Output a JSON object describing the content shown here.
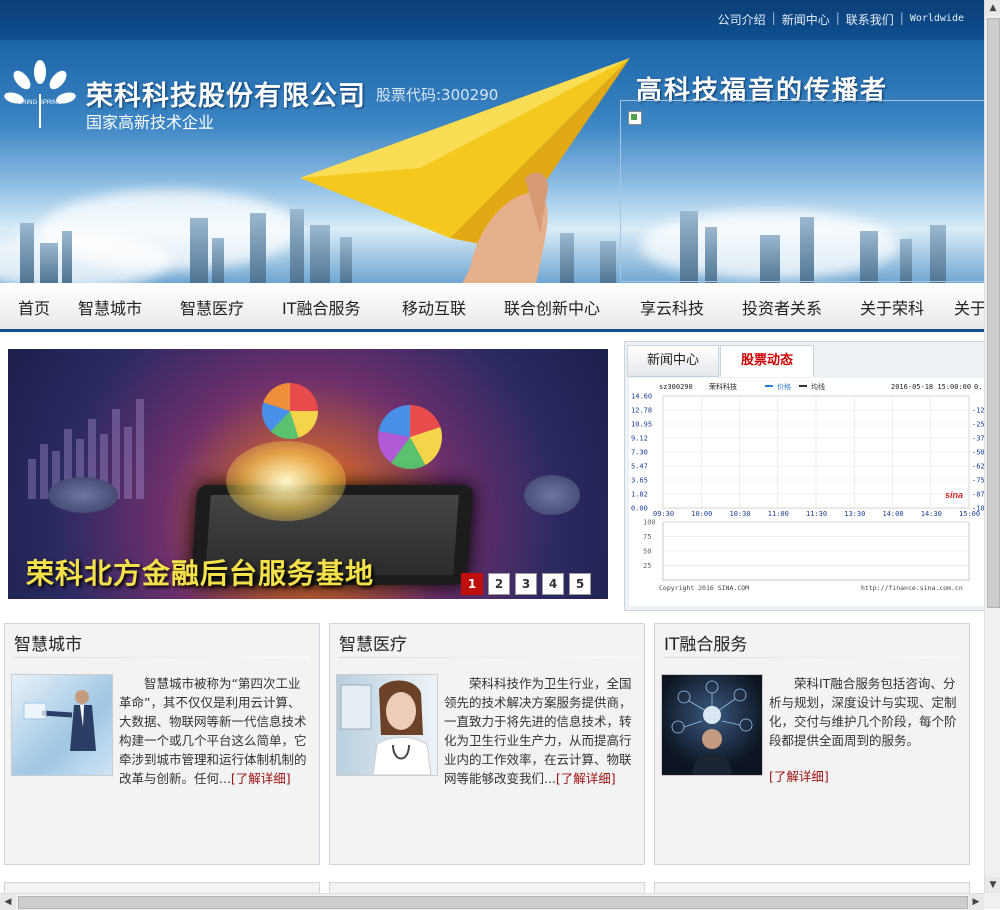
{
  "topbar": {
    "links": [
      "公司介绍",
      "新闻中心",
      "联系我们",
      "Worldwide"
    ]
  },
  "banner": {
    "company_name": "荣科科技股份有限公司",
    "stock_code": "股票代码:300290",
    "subtitle": "国家高新技术企业",
    "slogan": "高科技福音的传播者",
    "logo_text": "BRING SPRING"
  },
  "nav": {
    "items": [
      "首页",
      "智慧城市",
      "智慧医疗",
      "IT融合服务",
      "移动互联",
      "联合创新中心",
      "享云科技",
      "投资者关系",
      "关于荣科",
      "关于"
    ]
  },
  "slider": {
    "caption": "荣科北方金融后台服务基地",
    "pages": [
      "1",
      "2",
      "3",
      "4",
      "5"
    ],
    "active_page": "1"
  },
  "tabs": {
    "items": [
      "新闻中心",
      "股票动态"
    ],
    "active": "股票动态"
  },
  "stock_chart": {
    "symbol": "sz300290",
    "name": "荣科科技",
    "legend_price": "价格",
    "legend_avg": "均线",
    "datetime": "2016-05-18 15:00:00",
    "right_edge_label": "0.",
    "y_price_ticks": [
      "14.60",
      "12.78",
      "10.95",
      "9.12",
      "7.30",
      "5.47",
      "3.65",
      "1.82",
      "0.00"
    ],
    "y_pct_ticks": [
      "-12",
      "-25",
      "-37",
      "-50",
      "-62",
      "-75",
      "-87",
      "-10"
    ],
    "x_ticks": [
      "09:30",
      "10:00",
      "10:30",
      "11:00",
      "11:30",
      "13:30",
      "14:00",
      "14:30",
      "15:00"
    ],
    "vol_ticks": [
      "100",
      "75",
      "50",
      "25"
    ],
    "watermark": "sina",
    "copyright": "Copyright 2016 SINA.COM",
    "url": "http://finance.sina.com.cn"
  },
  "cards": [
    {
      "title": "智慧城市",
      "text": "智慧城市被称为“第四次工业革命”，其不仅仅是利用云计算、大数据、物联网等新一代信息技术构建一个或几个平台这么简单，它牵涉到城市管理和运行体制机制的改革与创新。任何...",
      "more": "[了解详细]"
    },
    {
      "title": "智慧医疗",
      "text": "荣科科技作为卫生行业，全国领先的技术解决方案服务提供商，一直致力于将先进的信息技术，转化为卫生行业生产力，从而提高行业内的工作效率，在云计算、物联网等能够改变我们...",
      "more": "[了解详细]"
    },
    {
      "title": "IT融合服务",
      "text": "荣科IT融合服务包括咨询、分析与规划，深度设计与实现、定制化，交付与维护几个阶段，每个阶段都提供全面周到的服务。",
      "more": "[了解详细]"
    }
  ],
  "colors": {
    "brand_blue": "#0e4f90",
    "accent_red": "#c00d0d",
    "caption_yellow": "#f5e14a",
    "more_link": "#9b1010"
  }
}
